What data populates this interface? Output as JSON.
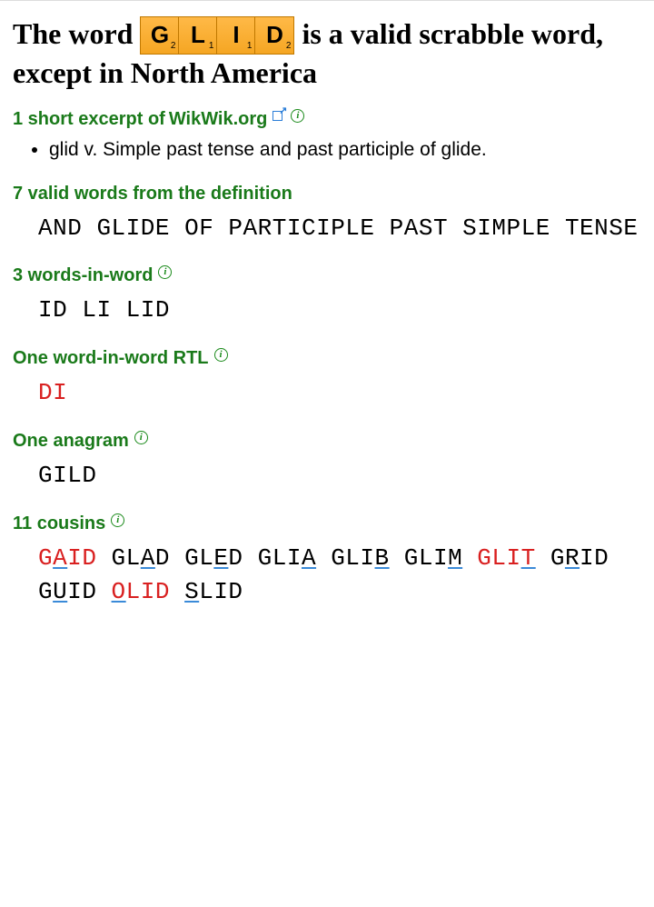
{
  "heading": {
    "prefix": "The word ",
    "suffix": " is a valid scrabble word, except in North America",
    "tiles": [
      {
        "letter": "G",
        "points": "2"
      },
      {
        "letter": "L",
        "points": "1"
      },
      {
        "letter": "I",
        "points": "1"
      },
      {
        "letter": "D",
        "points": "2"
      }
    ]
  },
  "excerpt": {
    "head_prefix": "1 short excerpt of ",
    "link_text": "WikWik.org",
    "items": [
      "glid v. Simple past tense and past participle of glide."
    ]
  },
  "valid_words": {
    "head": "7 valid words from the definition",
    "words": [
      {
        "text": "AND",
        "red": false
      },
      {
        "text": "GLIDE",
        "red": false
      },
      {
        "text": "OF",
        "red": false
      },
      {
        "text": "PARTICIPLE",
        "red": false
      },
      {
        "text": "PAST",
        "red": false
      },
      {
        "text": "SIMPLE",
        "red": false
      },
      {
        "text": "TENSE",
        "red": false
      }
    ]
  },
  "words_in_word": {
    "head": "3 words-in-word",
    "words": [
      {
        "text": "ID",
        "red": false
      },
      {
        "text": "LI",
        "red": false
      },
      {
        "text": "LID",
        "red": false
      }
    ]
  },
  "words_in_word_rtl": {
    "head": "One word-in-word RTL",
    "words": [
      {
        "text": "DI",
        "red": true
      }
    ]
  },
  "anagram": {
    "head": "One anagram",
    "words": [
      {
        "text": "GILD",
        "red": false
      }
    ]
  },
  "cousins": {
    "head": "11 cousins",
    "words": [
      {
        "text": "GAID",
        "red": true,
        "u": 1
      },
      {
        "text": "GLAD",
        "red": false,
        "u": 2
      },
      {
        "text": "GLED",
        "red": false,
        "u": 2
      },
      {
        "text": "GLIA",
        "red": false,
        "u": 3
      },
      {
        "text": "GLIB",
        "red": false,
        "u": 3
      },
      {
        "text": "GLIM",
        "red": false,
        "u": 3
      },
      {
        "text": "GLIT",
        "red": true,
        "u": 3
      },
      {
        "text": "GRID",
        "red": false,
        "u": 1
      },
      {
        "text": "GUID",
        "red": false,
        "u": 1
      },
      {
        "text": "OLID",
        "red": true,
        "u": 0
      },
      {
        "text": "SLID",
        "red": false,
        "u": 0
      }
    ]
  }
}
